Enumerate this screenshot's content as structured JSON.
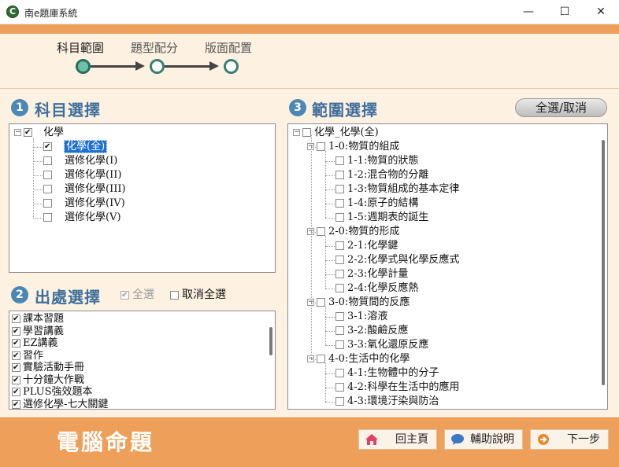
{
  "window": {
    "title": "南e題庫系統",
    "icon_glyph": "C",
    "min_glyph": "—",
    "max_glyph": "☐",
    "close_glyph": "✕"
  },
  "wizard": {
    "steps": [
      {
        "label": "科目範圍",
        "active": true
      },
      {
        "label": "題型配分",
        "active": false
      },
      {
        "label": "版面配置",
        "active": false
      }
    ]
  },
  "subject": {
    "num": "1",
    "title": "科目選擇",
    "root": {
      "label": "化學",
      "checked": true
    },
    "items": [
      {
        "label": "化學(全)",
        "checked": true,
        "selected": true
      },
      {
        "label": "選修化學(I)",
        "checked": false
      },
      {
        "label": "選修化學(II)",
        "checked": false
      },
      {
        "label": "選修化學(III)",
        "checked": false
      },
      {
        "label": "選修化學(IV)",
        "checked": false
      },
      {
        "label": "選修化學(V)",
        "checked": false
      }
    ]
  },
  "source": {
    "num": "2",
    "title": "出處選擇",
    "select_all_label": "全選",
    "deselect_all_label": "取消全選",
    "items": [
      {
        "label": "課本習題",
        "checked": true
      },
      {
        "label": "學習講義",
        "checked": true
      },
      {
        "label": "EZ講義",
        "checked": true
      },
      {
        "label": "習作",
        "checked": true
      },
      {
        "label": "實驗活動手冊",
        "checked": true
      },
      {
        "label": "十分鐘大作戰",
        "checked": true
      },
      {
        "label": "PLUS強效題本",
        "checked": true
      },
      {
        "label": "選修化學-七大關鍵",
        "checked": true
      }
    ]
  },
  "range": {
    "num": "3",
    "title": "範圍選擇",
    "toggle_all_label": "全選/取消",
    "root": "化學_化學(全)",
    "chapters": [
      {
        "label": "1-0:物質的組成",
        "sections": [
          "1-1:物質的狀態",
          "1-2:混合物的分離",
          "1-3:物質組成的基本定律",
          "1-4:原子的結構",
          "1-5:週期表的誕生"
        ]
      },
      {
        "label": "2-0:物質的形成",
        "sections": [
          "2-1:化學鍵",
          "2-2:化學式與化學反應式",
          "2-3:化學計量",
          "2-4:化學反應熱"
        ]
      },
      {
        "label": "3-0:物質間的反應",
        "sections": [
          "3-1:溶液",
          "3-2:酸鹼反應",
          "3-3:氧化還原反應"
        ]
      },
      {
        "label": "4-0:生活中的化學",
        "sections": [
          "4-1:生物體中的分子",
          "4-2:科學在生活中的應用",
          "4-3:環境汙染與防治"
        ]
      }
    ]
  },
  "footer": {
    "title": "電腦命題",
    "home_label": "回主頁",
    "help_label": "輔助說明",
    "next_label": "下一步"
  },
  "colors": {
    "accent_orange": "#eea05a",
    "section_blue": "#3f6f9c",
    "step_active": "#6cc0a8"
  }
}
